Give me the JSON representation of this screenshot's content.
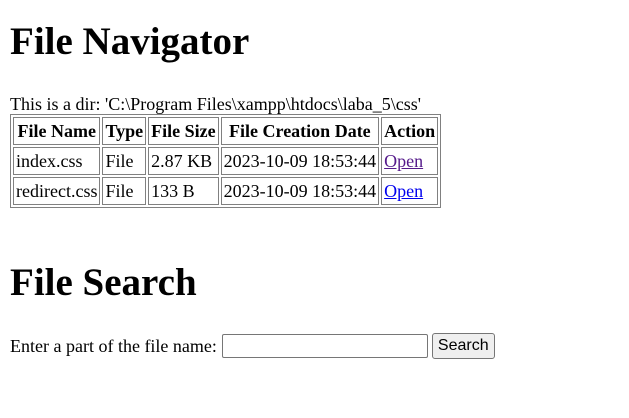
{
  "navigator": {
    "title": "File Navigator",
    "dir_line": "This is a dir: 'C:\\Program Files\\xampp\\htdocs\\laba_5\\css'",
    "columns": [
      "File Name",
      "Type",
      "File Size",
      "File Creation Date",
      "Action"
    ],
    "rows": [
      {
        "name": "index.css",
        "type": "File",
        "size": "2.87 KB",
        "date": "2023-10-09 18:53:44",
        "action": "Open",
        "visited": true
      },
      {
        "name": "redirect.css",
        "type": "File",
        "size": "133 B",
        "date": "2023-10-09 18:53:44",
        "action": "Open",
        "visited": false
      }
    ]
  },
  "search": {
    "title": "File Search",
    "prompt": "Enter a part of the file name:",
    "input_value": "",
    "button_label": "Search"
  },
  "colors": {
    "link_visited": "#551a8b",
    "link_unvisited": "#0000ee",
    "table_border": "#808080"
  }
}
